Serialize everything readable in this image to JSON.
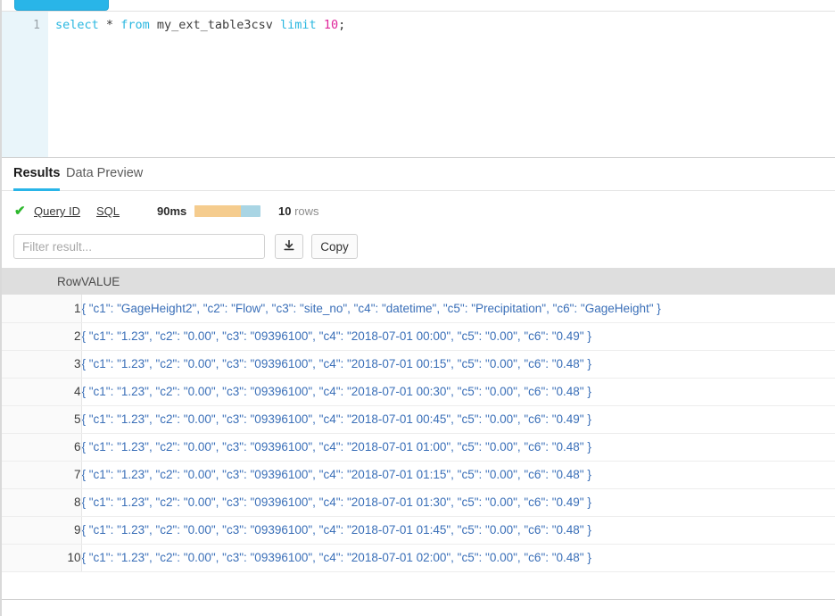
{
  "toolbar_top": {
    "run_button_label": ""
  },
  "editor": {
    "line_number": "1",
    "query_tokens": {
      "kw_select": "select",
      "star": "*",
      "kw_from": "from",
      "table": "my_ext_table3csv",
      "kw_limit": "limit",
      "number": "10",
      "semicolon": ";"
    },
    "query_text": "select * from my_ext_table3csv limit 10;"
  },
  "tabs": [
    {
      "label": "Results",
      "active": true
    },
    {
      "label": "Data Preview",
      "active": false
    }
  ],
  "status": {
    "check_icon": "check-icon",
    "query_id_label": "Query ID",
    "sql_label": "SQL",
    "duration": "90ms",
    "progress_percent": 70,
    "progress_fill_color": "#f5cc8e",
    "progress_track_color": "#a9d5e4",
    "row_count": "10",
    "rows_label": "rows"
  },
  "result_toolbar": {
    "filter_placeholder": "Filter result...",
    "filter_value": "",
    "download_icon": "download-icon",
    "copy_label": "Copy"
  },
  "table": {
    "columns": [
      "Row",
      "VALUE"
    ],
    "rows": [
      {
        "row": "1",
        "value": "{ \"c1\": \"GageHeight2\", \"c2\": \"Flow\", \"c3\": \"site_no\", \"c4\": \"datetime\", \"c5\": \"Precipitation\", \"c6\": \"GageHeight\" }"
      },
      {
        "row": "2",
        "value": "{ \"c1\": \"1.23\", \"c2\": \"0.00\", \"c3\": \"09396100\", \"c4\": \"2018-07-01 00:00\", \"c5\": \"0.00\", \"c6\": \"0.49\" }"
      },
      {
        "row": "3",
        "value": "{ \"c1\": \"1.23\", \"c2\": \"0.00\", \"c3\": \"09396100\", \"c4\": \"2018-07-01 00:15\", \"c5\": \"0.00\", \"c6\": \"0.48\" }"
      },
      {
        "row": "4",
        "value": "{ \"c1\": \"1.23\", \"c2\": \"0.00\", \"c3\": \"09396100\", \"c4\": \"2018-07-01 00:30\", \"c5\": \"0.00\", \"c6\": \"0.48\" }"
      },
      {
        "row": "5",
        "value": "{ \"c1\": \"1.23\", \"c2\": \"0.00\", \"c3\": \"09396100\", \"c4\": \"2018-07-01 00:45\", \"c5\": \"0.00\", \"c6\": \"0.49\" }"
      },
      {
        "row": "6",
        "value": "{ \"c1\": \"1.23\", \"c2\": \"0.00\", \"c3\": \"09396100\", \"c4\": \"2018-07-01 01:00\", \"c5\": \"0.00\", \"c6\": \"0.48\" }"
      },
      {
        "row": "7",
        "value": "{ \"c1\": \"1.23\", \"c2\": \"0.00\", \"c3\": \"09396100\", \"c4\": \"2018-07-01 01:15\", \"c5\": \"0.00\", \"c6\": \"0.48\" }"
      },
      {
        "row": "8",
        "value": "{ \"c1\": \"1.23\", \"c2\": \"0.00\", \"c3\": \"09396100\", \"c4\": \"2018-07-01 01:30\", \"c5\": \"0.00\", \"c6\": \"0.49\" }"
      },
      {
        "row": "9",
        "value": "{ \"c1\": \"1.23\", \"c2\": \"0.00\", \"c3\": \"09396100\", \"c4\": \"2018-07-01 01:45\", \"c5\": \"0.00\", \"c6\": \"0.48\" }"
      },
      {
        "row": "10",
        "value": "{ \"c1\": \"1.23\", \"c2\": \"0.00\", \"c3\": \"09396100\", \"c4\": \"2018-07-01 02:00\", \"c5\": \"0.00\", \"c6\": \"0.48\" }"
      }
    ]
  },
  "colors": {
    "accent": "#29b5e8",
    "value_text": "#3a6fb8",
    "keyword": "#2ab7e0",
    "number": "#e0269b",
    "success": "#2eb82e"
  }
}
